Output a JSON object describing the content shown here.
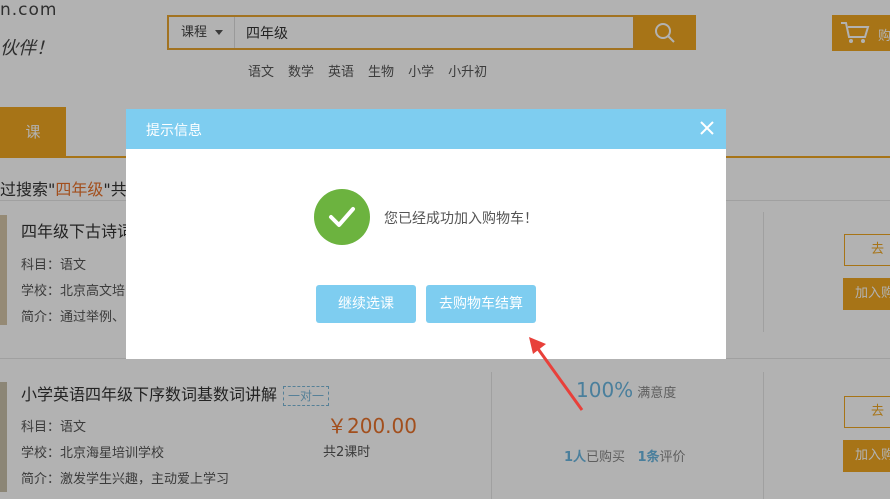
{
  "header": {
    "logo_text": "n.com",
    "slogan": "伙伴！",
    "search": {
      "category": "课程",
      "value": "四年级"
    },
    "hot_links": [
      "语文",
      "数学",
      "英语",
      "生物",
      "小学",
      "小升初"
    ],
    "cart_label": "购"
  },
  "nav": {
    "active_tab": "课"
  },
  "results": {
    "prefix": "过搜索\"",
    "keyword": "四年级",
    "suffix": "\"共"
  },
  "courses": [
    {
      "title": "四年级下古诗词",
      "subject_label": "科目：",
      "subject": "语文",
      "school_label": "学校：",
      "school": "北京高文培",
      "intro_label": "简介：",
      "intro": "通过举例、",
      "btn_go": "去",
      "btn_add": "加入购"
    },
    {
      "title": "小学英语四年级下序数词基数词讲解",
      "tag": "一对一",
      "subject_label": "科目：",
      "subject": "语文",
      "school_label": "学校：",
      "school": "北京海星培训学校",
      "intro_label": "简介：",
      "intro": "激发学生兴趣，主动爱上学习",
      "price": "￥200.00",
      "hours": "共2课时",
      "satisfaction": "100%",
      "satisfaction_label": "满意度",
      "buyers_num": "1人",
      "buyers_label": "已购买",
      "reviews_num": "1条",
      "reviews_label": "评价",
      "btn_go": "去",
      "btn_add": "加入购"
    }
  ],
  "modal": {
    "title": "提示信息",
    "message": "您已经成功加入购物车！",
    "continue_label": "继续选课",
    "checkout_label": "去购物车结算"
  },
  "colors": {
    "accent_orange": "#f0a722",
    "modal_blue": "#7ecdf0",
    "success_green": "#6cb33f",
    "arrow_red": "#e8403a"
  }
}
